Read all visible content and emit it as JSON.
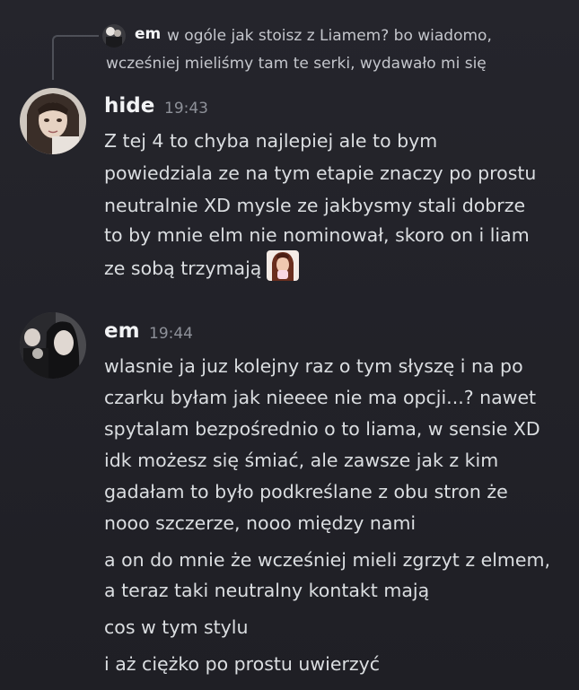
{
  "reply": {
    "author": "em",
    "text_line1": "w ogóle jak stoisz z Liamem? bo wiadomo,",
    "text_line2": "wcześniej mieliśmy tam te serki, wydawało mi się"
  },
  "messages": [
    {
      "author": "hide",
      "time": "19:43",
      "lines": [
        "Z tej 4 to chyba najlepiej ale to bym",
        "powiedziala ze na tym etapie znaczy po prostu",
        "neutralnie XD mysle ze jakbysmy stali dobrze",
        "to by mnie elm nie nominował, skoro on i liam",
        "ze sobą trzymają"
      ],
      "emoji": "crying-woman-emoji"
    },
    {
      "author": "em",
      "time": "19:44",
      "lines": [
        "wlasnie ja juz kolejny raz o tym słyszę i na po",
        "czarku byłam jak nieeee nie ma opcji...? nawet",
        "spytalam bezpośrednio o to liama, w sensie XD",
        "idk możesz się śmiać, ale zawsze jak z kim",
        "gadałam to było podkreślane z obu stron że",
        "nooo szczerze, nooo między nami"
      ],
      "followups": [
        "a on do mnie że wcześniej mieli zgrzyt z elmem,",
        "a teraz taki neutralny kontakt mają",
        "cos w tym stylu",
        "i aż ciężko po prostu uwierzyć"
      ]
    }
  ],
  "colors": {
    "background": "#24242a",
    "text": "#dbdee1",
    "username": "#f2f3f5",
    "timestamp": "#8e9199"
  }
}
